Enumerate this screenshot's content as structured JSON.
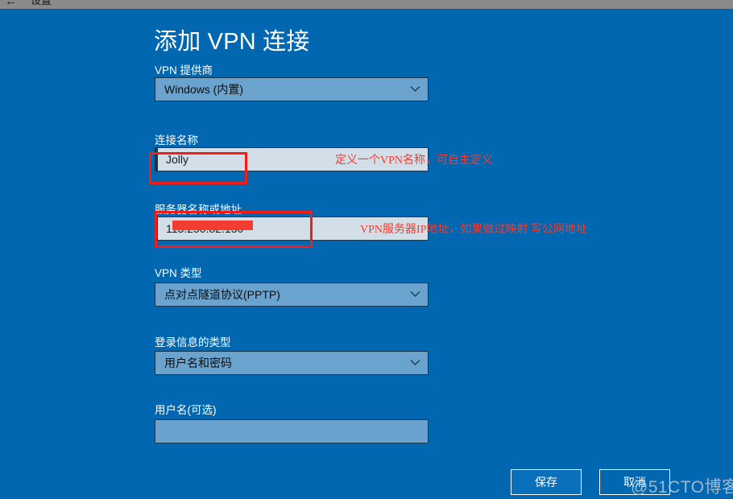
{
  "window": {
    "back_icon": "back-arrow-icon",
    "app_title": "设置"
  },
  "page": {
    "title": "添加 VPN 连接"
  },
  "fields": [
    {
      "key": "vpn_provider",
      "label": "VPN 提供商",
      "control": "combo",
      "value": "Windows (内置)",
      "chevron_icon": "chevron-down-icon"
    },
    {
      "key": "connection_name",
      "label": "连接名称",
      "control": "text",
      "value": "Jolly",
      "placeholder": ""
    },
    {
      "key": "server_address",
      "label": "服务器名称或地址",
      "control": "text",
      "value": "113.250.82.150",
      "placeholder": "",
      "redacted": true
    },
    {
      "key": "vpn_type",
      "label": "VPN 类型",
      "control": "combo",
      "value": "点对点隧道协议(PPTP)",
      "chevron_icon": "chevron-down-icon"
    },
    {
      "key": "signin_info_type",
      "label": "登录信息的类型",
      "control": "combo",
      "value": "用户名和密码",
      "chevron_icon": "chevron-down-icon"
    },
    {
      "key": "user_name",
      "label": "用户名(可选)",
      "control": "text",
      "value": "",
      "placeholder": ""
    }
  ],
  "annotations": [
    {
      "key": "connection_name_note",
      "text": "定义一个VPN名称，可自主定义",
      "color": "#f63a2e"
    },
    {
      "key": "server_address_note",
      "text": "VPN服务器IP地址，如果做过映射 写公网地址",
      "color": "#f63a2e"
    }
  ],
  "buttons": {
    "save": "保存",
    "cancel": "取消"
  },
  "watermark": {
    "text": "@51CTO博客"
  },
  "colors": {
    "background": "#0067b0",
    "combo_fill": "#6ba3cf",
    "textbox_fill": "#d3dfe8",
    "control_border": "#17384f",
    "annotation_red": "#f63a2e",
    "highlight_box": "#f61b14",
    "save_button": "#0a70bb",
    "titlebar": "#8a8a8a"
  }
}
